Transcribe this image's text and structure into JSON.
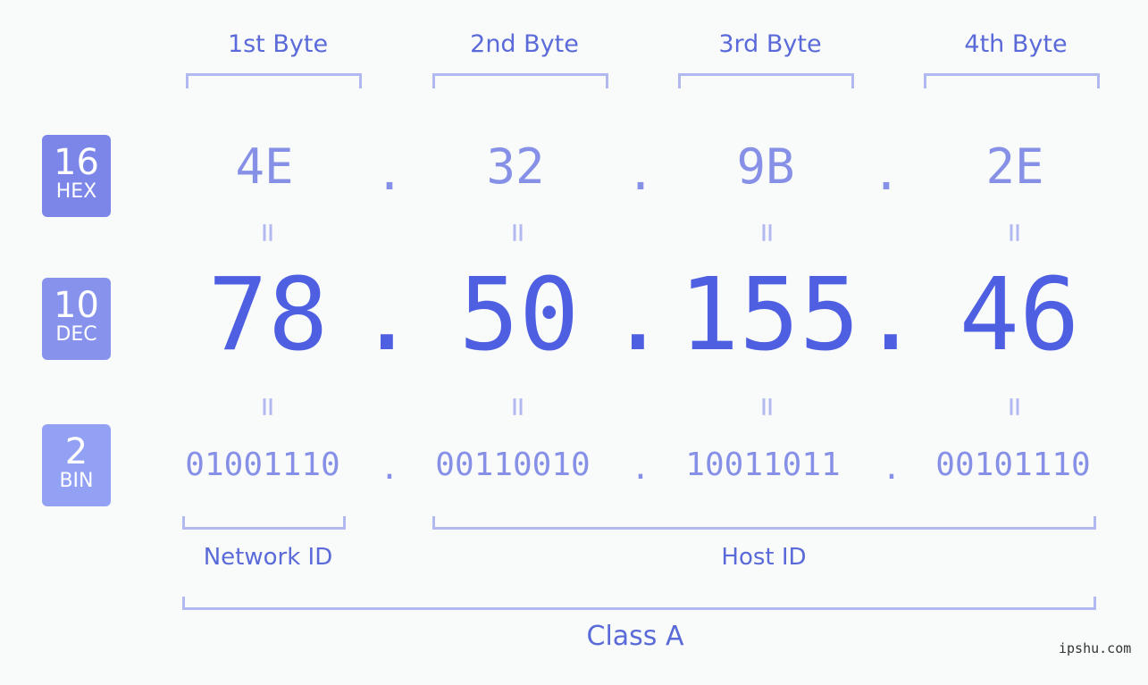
{
  "bytes": [
    {
      "header": "1st Byte",
      "hex": "4E",
      "dec": "78",
      "bin": "01001110"
    },
    {
      "header": "2nd Byte",
      "hex": "32",
      "dec": "50",
      "bin": "00110010"
    },
    {
      "header": "3rd Byte",
      "hex": "9B",
      "dec": "155",
      "bin": "10011011"
    },
    {
      "header": "4th Byte",
      "hex": "2E",
      "dec": "46",
      "bin": "00101110"
    }
  ],
  "separator": ".",
  "equals": "=",
  "badges": {
    "hex": {
      "number": "16",
      "label": "HEX",
      "color": "#7b86e8"
    },
    "dec": {
      "number": "10",
      "label": "DEC",
      "color": "#8792ec"
    },
    "bin": {
      "number": "2",
      "label": "BIN",
      "color": "#93a1f5"
    }
  },
  "labels": {
    "network_id": "Network ID",
    "host_id": "Host ID",
    "class": "Class A"
  },
  "watermark": "ipshu.com"
}
